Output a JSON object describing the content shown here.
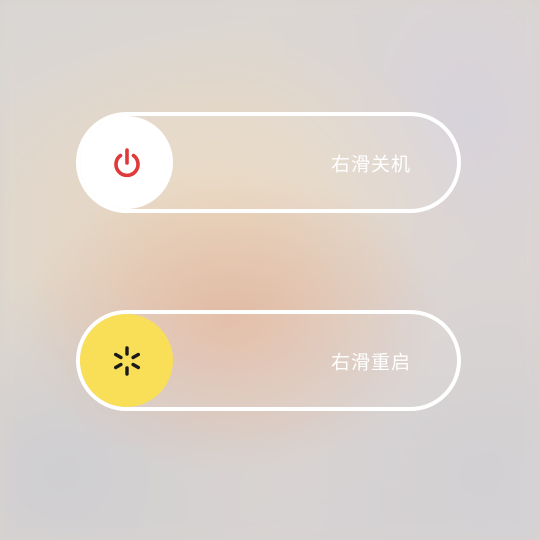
{
  "power_slider": {
    "label": "右滑关机",
    "icon": "power-icon",
    "knob_color": "#ffffff",
    "icon_color": "#e0393a"
  },
  "restart_slider": {
    "label": "右滑重启",
    "icon": "restart-icon",
    "knob_color": "#f9de58",
    "icon_color": "#1a1a1a"
  }
}
